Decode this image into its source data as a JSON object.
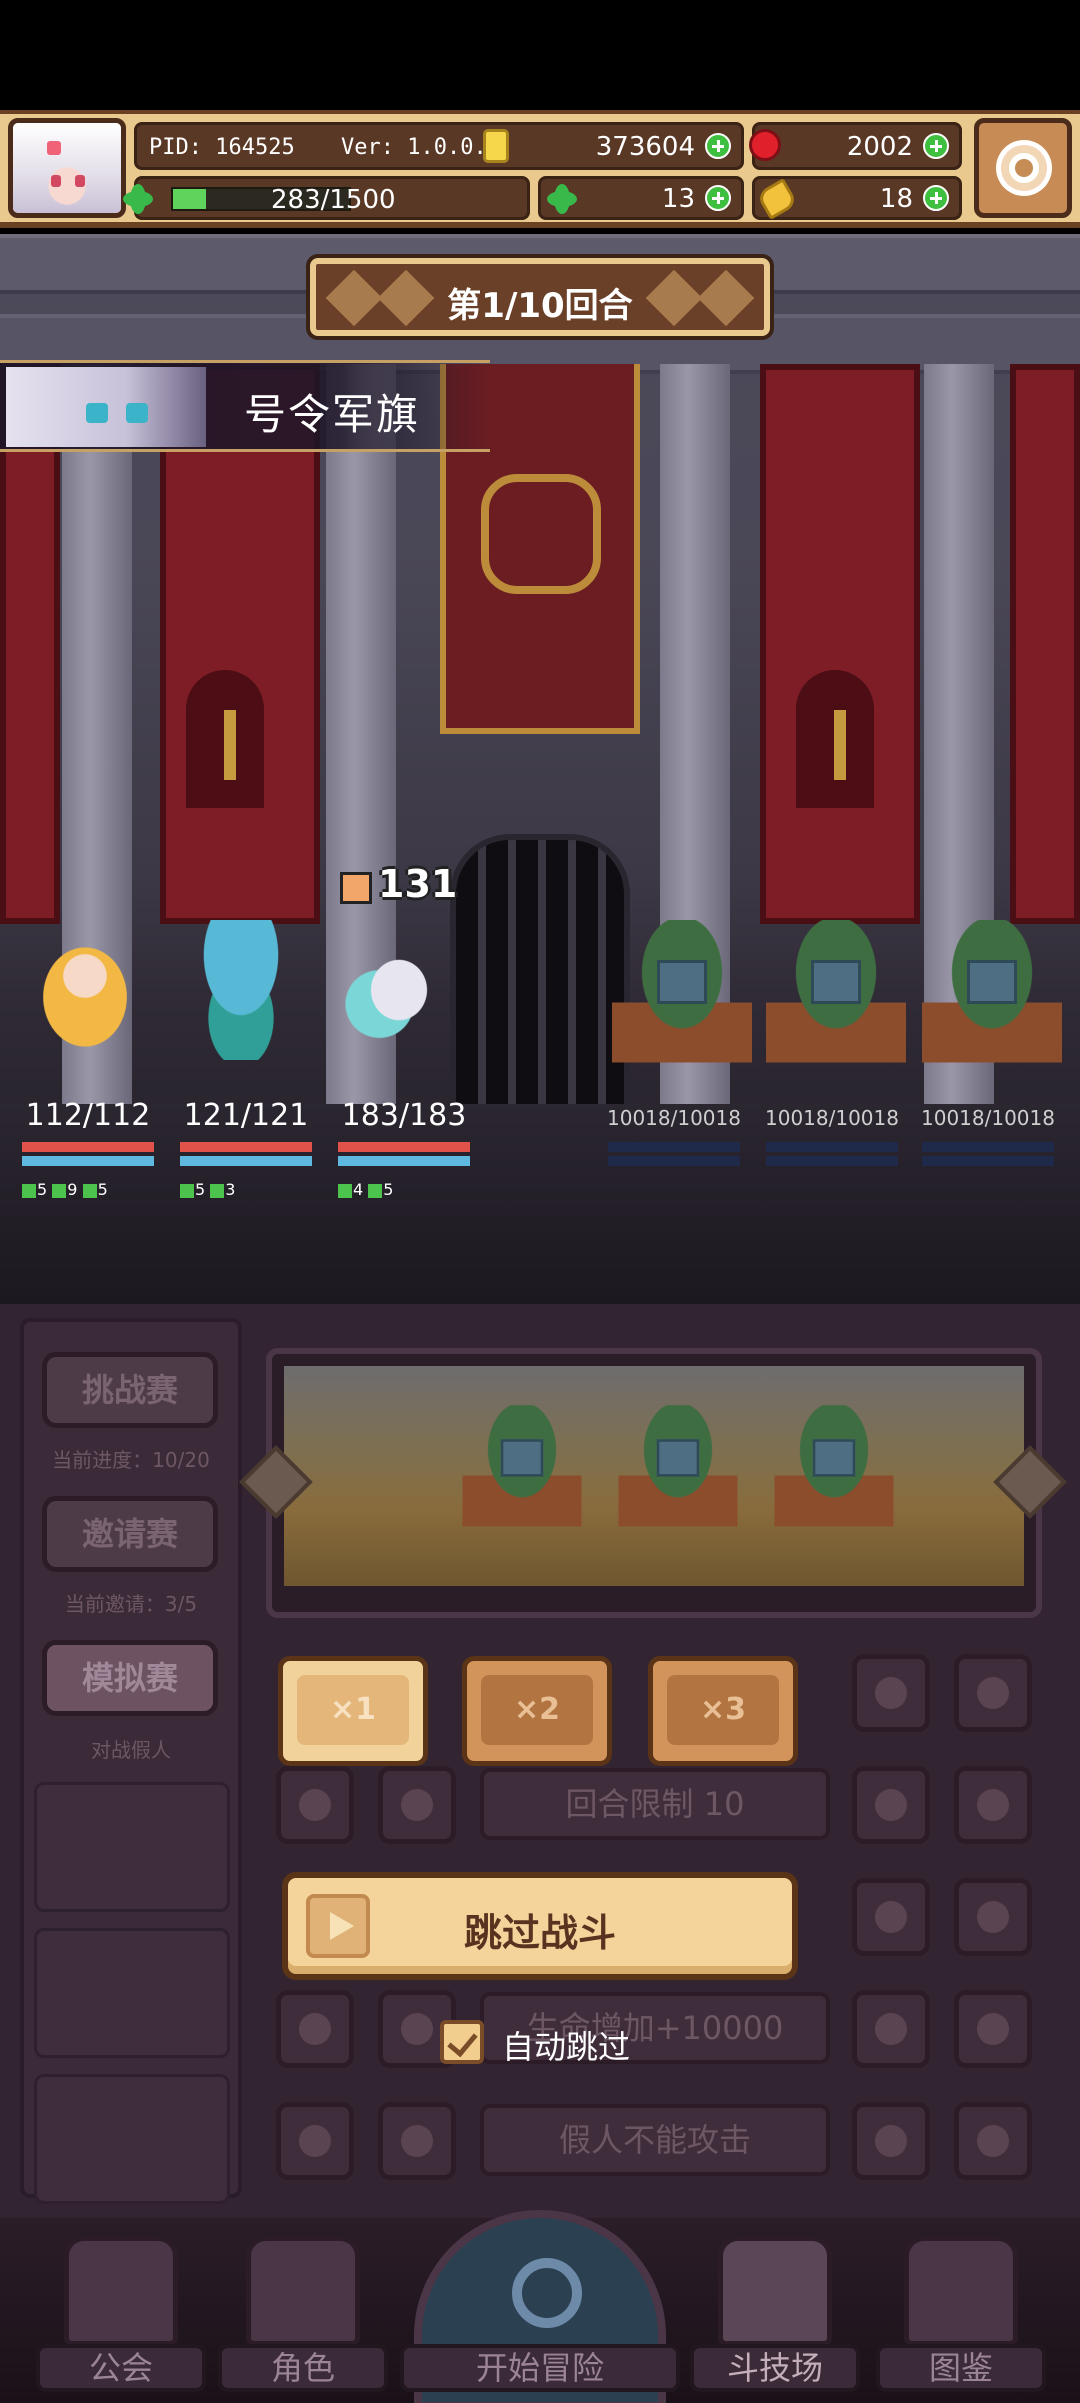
{
  "header": {
    "pid": "PID: 164525",
    "version": "Ver: 1.0.0.0",
    "gold": "373604",
    "gems": "2002",
    "xp_text": "283/1500",
    "xp_fraction": 0.189,
    "clovers": "13",
    "keys": "18"
  },
  "battle": {
    "round_label": "第1/10回合",
    "skill_name": "号令军旗",
    "damage_number": "131",
    "allies": [
      {
        "hp": "112/112",
        "buffs": [
          "5",
          "9",
          "5"
        ]
      },
      {
        "hp": "121/121",
        "buffs": [
          "5",
          "3"
        ]
      },
      {
        "hp": "183/183",
        "buffs": [
          "4",
          "5"
        ]
      }
    ],
    "enemies": [
      {
        "hp": "10018/10018"
      },
      {
        "hp": "10018/10018"
      },
      {
        "hp": "10018/10018"
      }
    ]
  },
  "sidebar": {
    "challenge": {
      "label": "挑战赛",
      "sub": "当前进度：10/20"
    },
    "invite": {
      "label": "邀请赛",
      "sub": "当前邀请：3/5"
    },
    "mock": {
      "label": "模拟赛",
      "sub": "对战假人"
    }
  },
  "settings_rows": [
    {
      "label": "回合限制 10"
    },
    {
      "label": "生命增加+10000"
    },
    {
      "label": "假人不能攻击"
    }
  ],
  "speed": {
    "x1": "×1",
    "x2": "×2",
    "x3": "×3",
    "selected": "x1"
  },
  "skip": {
    "label": "跳过战斗",
    "auto_label": "自动跳过",
    "auto_checked": true
  },
  "nav": {
    "guild": "公会",
    "characters": "角色",
    "adventure": "开始冒险",
    "arena": "斗技场",
    "codex": "图鉴"
  },
  "colors": {
    "hp_bar": "#e0524a",
    "mp_bar": "#5fb8e0",
    "enemy_bar": "#1f2a4a",
    "gold_panel": "#e9c98d"
  }
}
